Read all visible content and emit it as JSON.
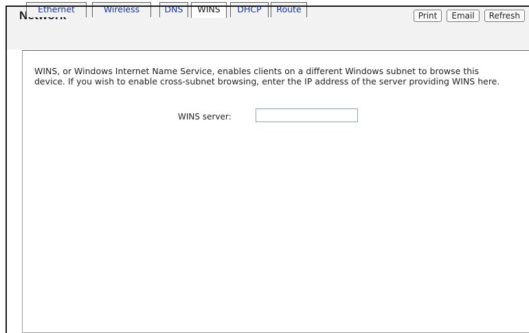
{
  "header": {
    "title": "Network",
    "actions": {
      "print": "Print",
      "email": "Email",
      "refresh": "Refresh"
    }
  },
  "tabs": [
    {
      "label": "Ethernet",
      "active": false
    },
    {
      "label": "Wireless",
      "active": false
    },
    {
      "label": "DNS",
      "active": false
    },
    {
      "label": "WINS",
      "active": true
    },
    {
      "label": "DHCP",
      "active": false
    },
    {
      "label": "Route",
      "active": false
    }
  ],
  "main": {
    "description": "WINS, or Windows Internet Name Service, enables clients on a different Windows subnet to browse this device. If you wish to enable cross-subnet browsing, enter the IP address of the server providing WINS here.",
    "wins_server": {
      "label": "WINS server:",
      "value": ""
    }
  }
}
